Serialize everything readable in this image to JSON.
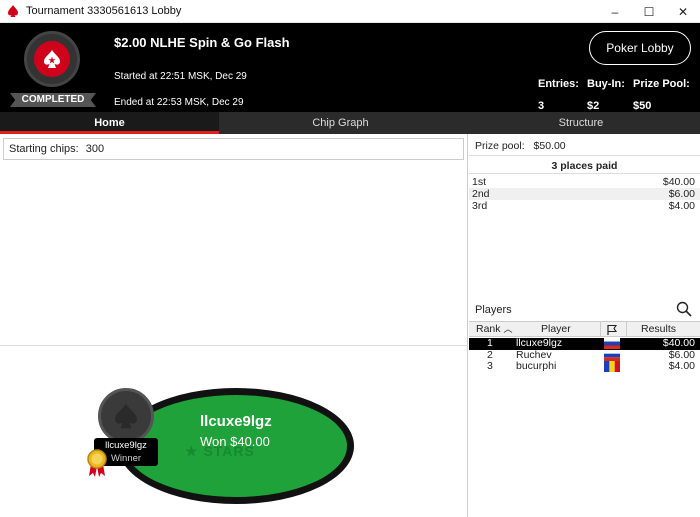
{
  "window": {
    "title": "Tournament 3330561613 Lobby",
    "minimize": "–",
    "maximize": "☐",
    "close": "✕"
  },
  "header": {
    "status_badge": "COMPLETED",
    "tournament_name": "$2.00 NLHE Spin & Go Flash",
    "started": "Started at 22:51 MSK, Dec 29",
    "ended": "Ended at 22:53 MSK, Dec 29",
    "lobby_button": "Poker Lobby",
    "stats": [
      {
        "label": "Entries:",
        "value": "3"
      },
      {
        "label": "Buy-In:",
        "value": "$2"
      },
      {
        "label": "Prize Pool:",
        "value": "$50"
      }
    ]
  },
  "tabs": [
    {
      "label": "Home",
      "active": true
    },
    {
      "label": "Chip Graph",
      "active": false
    },
    {
      "label": "Structure",
      "active": false
    }
  ],
  "left": {
    "starting_chips_label": "Starting chips:",
    "starting_chips_value": "300",
    "table": {
      "winner_name": "llcuxe9lgz",
      "winner_won": "Won $40.00",
      "seat_name": "llcuxe9lgz",
      "seat_status": "Winner",
      "felt_logo": "★ STARS"
    }
  },
  "right": {
    "prize_pool_label": "Prize pool:",
    "prize_pool_value": "$50.00",
    "places_paid": "3 places paid",
    "payouts": [
      {
        "place": "1st",
        "amount": "$40.00"
      },
      {
        "place": "2nd",
        "amount": "$6.00"
      },
      {
        "place": "3rd",
        "amount": "$4.00"
      }
    ],
    "players_label": "Players",
    "columns": {
      "rank": "Rank",
      "player": "Player",
      "results": "Results"
    },
    "players": [
      {
        "rank": "1",
        "name": "llcuxe9lgz",
        "flag": "russia-flag",
        "result": "$40.00",
        "selected": true
      },
      {
        "rank": "2",
        "name": "Ruchev",
        "flag": "russia-flag",
        "result": "$6.00",
        "selected": false
      },
      {
        "rank": "3",
        "name": "bucurphi",
        "flag": "romania-flag",
        "result": "$4.00",
        "selected": false
      }
    ]
  },
  "colors": {
    "accent": "#e0201b",
    "felt": "#1fa23a",
    "header_bg": "#000000"
  }
}
